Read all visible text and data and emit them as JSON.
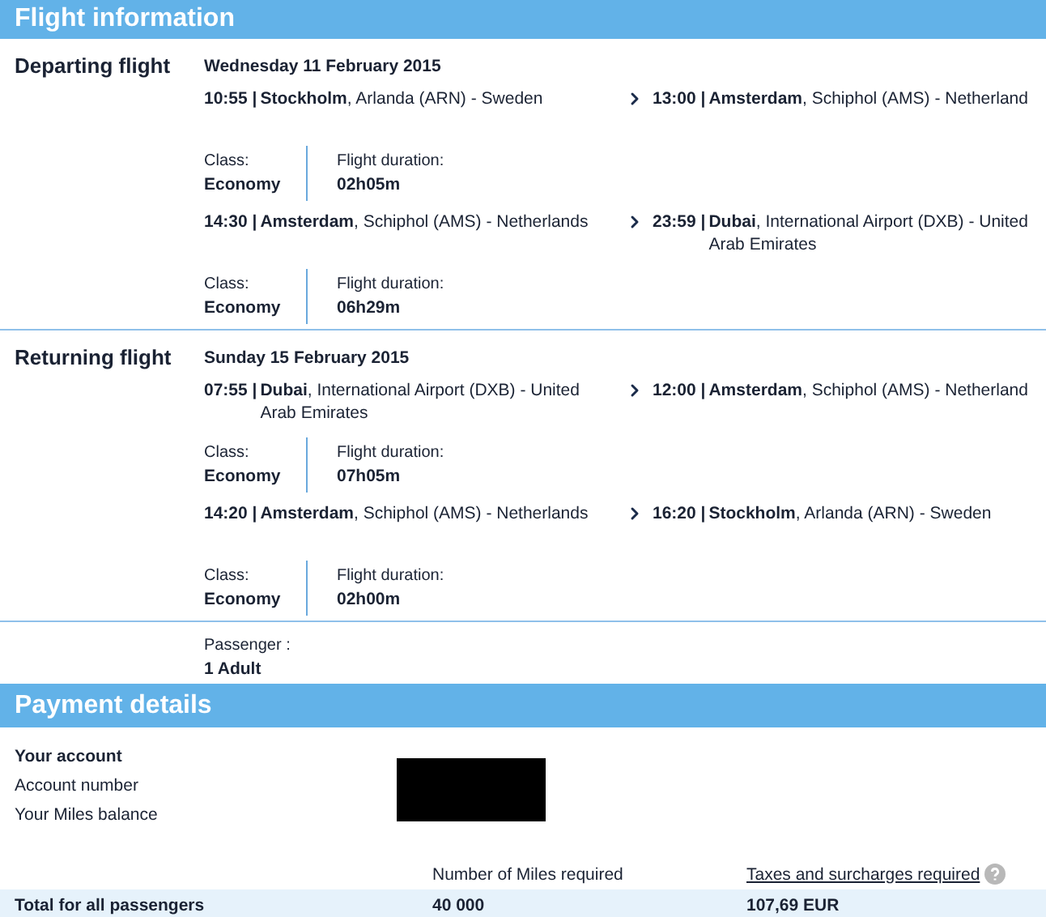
{
  "flight_header": "Flight information",
  "flights": [
    {
      "label": "Departing flight",
      "date": "Wednesday 11 February 2015",
      "segments": [
        {
          "dep_time": "10:55 |",
          "dep_place": "**Stockholm**, Arlanda (ARN) - Sweden",
          "arr_time": "13:00 |",
          "arr_place": "**Amsterdam**, Schiphol (AMS) - Netherland",
          "class_label": "Class:",
          "class": "Economy",
          "duration_label": "Flight duration:",
          "duration": "02h05m"
        },
        {
          "dep_time": "14:30 |",
          "dep_place": "**Amsterdam**, Schiphol (AMS) - Netherlands",
          "arr_time": "23:59 |",
          "arr_place": "**Dubai**, International Airport (DXB) - United Arab Emirates",
          "class_label": "Class:",
          "class": "Economy",
          "duration_label": "Flight duration:",
          "duration": "06h29m"
        }
      ]
    },
    {
      "label": "Returning flight",
      "date": "Sunday 15 February 2015",
      "segments": [
        {
          "dep_time": "07:55 |",
          "dep_place": "**Dubai**, International Airport (DXB) - United Arab Emirates",
          "arr_time": "12:00 |",
          "arr_place": "**Amsterdam**, Schiphol (AMS) - Netherland",
          "class_label": "Class:",
          "class": "Economy",
          "duration_label": "Flight duration:",
          "duration": "07h05m"
        },
        {
          "dep_time": "14:20 |",
          "dep_place": "**Amsterdam**, Schiphol (AMS) - Netherlands",
          "arr_time": "16:20 |",
          "arr_place": "**Stockholm**, Arlanda (ARN) - Sweden",
          "class_label": "Class:",
          "class": "Economy",
          "duration_label": "Flight duration:",
          "duration": "02h00m"
        }
      ]
    }
  ],
  "passenger": {
    "label": "Passenger :",
    "value": "1 Adult"
  },
  "payment_header": "Payment details",
  "account": {
    "title": "Your account",
    "rows": [
      "Account number",
      "Your Miles balance"
    ]
  },
  "totals": {
    "miles_heading": "Number of Miles required",
    "taxes_link": "Taxes and surcharges required",
    "row_label": "Total for all passengers",
    "miles": "40 000",
    "taxes": "107,69 EUR"
  }
}
